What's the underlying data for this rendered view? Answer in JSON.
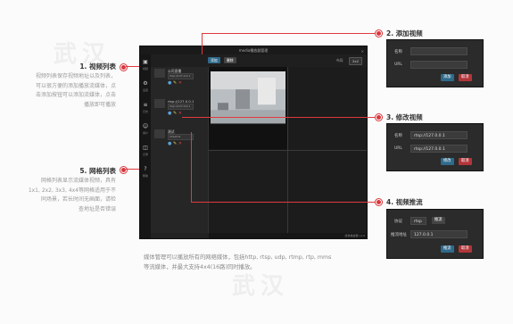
{
  "window": {
    "title": "media播放器管理",
    "toolbar": {
      "add_label": "添加",
      "delete_label": "删除",
      "layout_label": "布局",
      "layout_value": "2x2"
    },
    "nav": [
      "视频",
      "设置",
      "日志",
      "用户",
      "记录",
      "帮助"
    ],
    "playlist": [
      {
        "name": "公司直播",
        "url": "rtsp://127.0.0.1"
      },
      {
        "name": "rtsp://127.0.0.1",
        "url": "rtsp://127.0.0.1"
      },
      {
        "name": "测试",
        "url": "stream1"
      }
    ],
    "status": "媒体播放器 v1.0"
  },
  "annotations": {
    "video_list": {
      "title": "1. 视频列表",
      "text": "视频列表保存视频地址以及列表，\n可以很方便的添加播放流媒体，点\n击添加按钮可以添加流媒体，点击\n播放即可播放"
    },
    "grid_list": {
      "title": "5. 网格列表",
      "text": "网格列表显示流媒体视频，具有\n1x1, 2x2, 3x3, 4x4等网格适用于不\n同场景，若长时间无画面，请检\n查地址是否错误"
    },
    "add_video": {
      "title": "2. 添加视频"
    },
    "edit_video": {
      "title": "3. 修改视频"
    },
    "video_push": {
      "title": "4. 视频推流"
    }
  },
  "add_panel": {
    "name_label": "名称",
    "name_value": "",
    "url_label": "URL",
    "url_value": "",
    "ok_label": "添加",
    "cancel_label": "取消"
  },
  "edit_panel": {
    "name_label": "名称",
    "name_value": "rtsp://127.0.0.1",
    "url_label": "URL",
    "url_value": "rtsp://127.0.0.1",
    "ok_label": "修改",
    "cancel_label": "取消"
  },
  "push_panel": {
    "protocol_label": "协议",
    "protocol_value": "rtsp",
    "port_button": "推流",
    "addr_label": "推流地址",
    "addr_value": "127.0.0.1",
    "ok_label": "推流",
    "cancel_label": "取消"
  },
  "bottom_text": "媒体管理可以播放所有的网络媒体，包括http, rtsp, udp, rtmp, rtp, mms\n等流媒体，并最大支持4x4(16路)同时播放。",
  "watermark": "武汉"
}
